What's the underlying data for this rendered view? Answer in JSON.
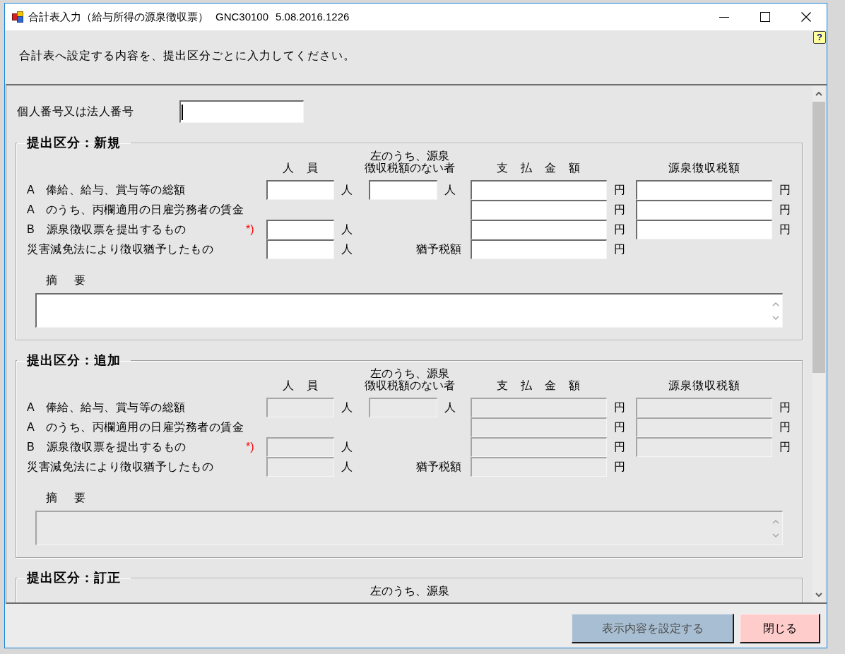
{
  "window": {
    "title": "合計表入力（給与所得の源泉徴収票）",
    "program_id": "GNC30100",
    "version": "5.08.2016.1226"
  },
  "help": {
    "glyph": "?"
  },
  "instruction": "合計表へ設定する内容を、提出区分ごとに入力してください。",
  "id_number": {
    "label": "個人番号又は法人番号",
    "focused": true
  },
  "sections": [
    {
      "legend": "提出区分：新規",
      "disabled": false,
      "headers": {
        "count": [
          "人　員"
        ],
        "exempt": [
          "左のうち、源泉",
          "徴収税額のない者"
        ],
        "payment": [
          "支　払　金　額"
        ],
        "tax": [
          "源泉徴収税額"
        ]
      },
      "rows": [
        {
          "label": "A　俸給、給与、賞与等の総額",
          "count": {
            "unit": "人"
          },
          "exempt": {
            "unit": "人"
          },
          "payment": {
            "unit": "円"
          },
          "tax": {
            "unit": "円"
          }
        },
        {
          "label": "A　のうち、丙欄適用の日雇労務者の賃金",
          "payment": {
            "unit": "円"
          },
          "tax": {
            "unit": "円"
          }
        },
        {
          "label": "B　源泉徴収票を提出するもの",
          "note": "*)",
          "count": {
            "unit": "人"
          },
          "payment": {
            "unit": "円"
          },
          "tax": {
            "unit": "円"
          }
        },
        {
          "label": "災害減免法により徴収猶予したもの",
          "count": {
            "unit": "人"
          },
          "payment": {
            "caption": "猶予税額",
            "unit": "円"
          }
        }
      ],
      "summary_label": "摘　要"
    },
    {
      "legend": "提出区分：追加",
      "disabled": true,
      "headers": {
        "count": [
          "人　員"
        ],
        "exempt": [
          "左のうち、源泉",
          "徴収税額のない者"
        ],
        "payment": [
          "支　払　金　額"
        ],
        "tax": [
          "源泉徴収税額"
        ]
      },
      "rows": [
        {
          "label": "A　俸給、給与、賞与等の総額",
          "count": {
            "unit": "人"
          },
          "exempt": {
            "unit": "人"
          },
          "payment": {
            "unit": "円"
          },
          "tax": {
            "unit": "円"
          }
        },
        {
          "label": "A　のうち、丙欄適用の日雇労務者の賃金",
          "payment": {
            "unit": "円"
          },
          "tax": {
            "unit": "円"
          }
        },
        {
          "label": "B　源泉徴収票を提出するもの",
          "note": "*)",
          "count": {
            "unit": "人"
          },
          "payment": {
            "unit": "円"
          },
          "tax": {
            "unit": "円"
          }
        },
        {
          "label": "災害減免法により徴収猶予したもの",
          "count": {
            "unit": "人"
          },
          "payment": {
            "caption": "猶予税額",
            "unit": "円"
          }
        }
      ],
      "summary_label": "摘　要"
    },
    {
      "legend": "提出区分：訂正",
      "headers": {
        "exempt": [
          "左のうち、源泉"
        ]
      }
    }
  ],
  "buttons": [
    {
      "label": "表示内容を設定する",
      "kind": "apply",
      "disabled": true
    },
    {
      "label": "閉じる",
      "kind": "close",
      "disabled": false
    }
  ]
}
